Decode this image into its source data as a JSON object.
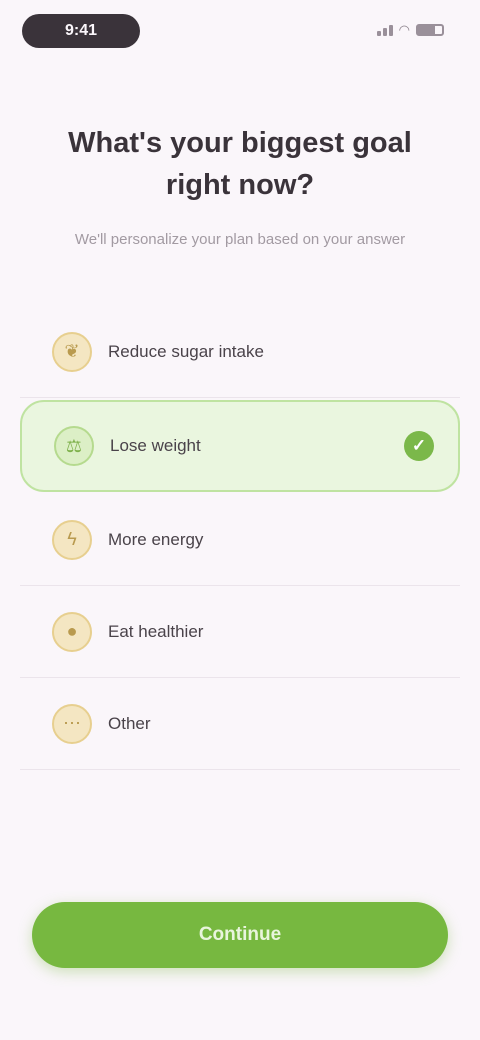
{
  "status_bar": {
    "time": "9:41"
  },
  "screen": {
    "title": "What's your biggest goal right now?",
    "subtitle": "We'll personalize your plan based on your answer"
  },
  "options": [
    {
      "label": "Reduce sugar intake",
      "icon": "leaf-icon",
      "selected": false
    },
    {
      "label": "Lose weight",
      "icon": "scale-icon",
      "selected": true
    },
    {
      "label": "More energy",
      "icon": "lightning-icon",
      "selected": false
    },
    {
      "label": "Eat healthier",
      "icon": "apple-icon",
      "selected": false
    },
    {
      "label": "Other",
      "icon": "dots-icon",
      "selected": false
    }
  ],
  "continue_button": {
    "label": "Continue"
  },
  "colors": {
    "accent": "#77b840",
    "selected_bg": "#eaf6df",
    "icon_bg": "#f4e6c2",
    "background": "#faf6fa"
  }
}
